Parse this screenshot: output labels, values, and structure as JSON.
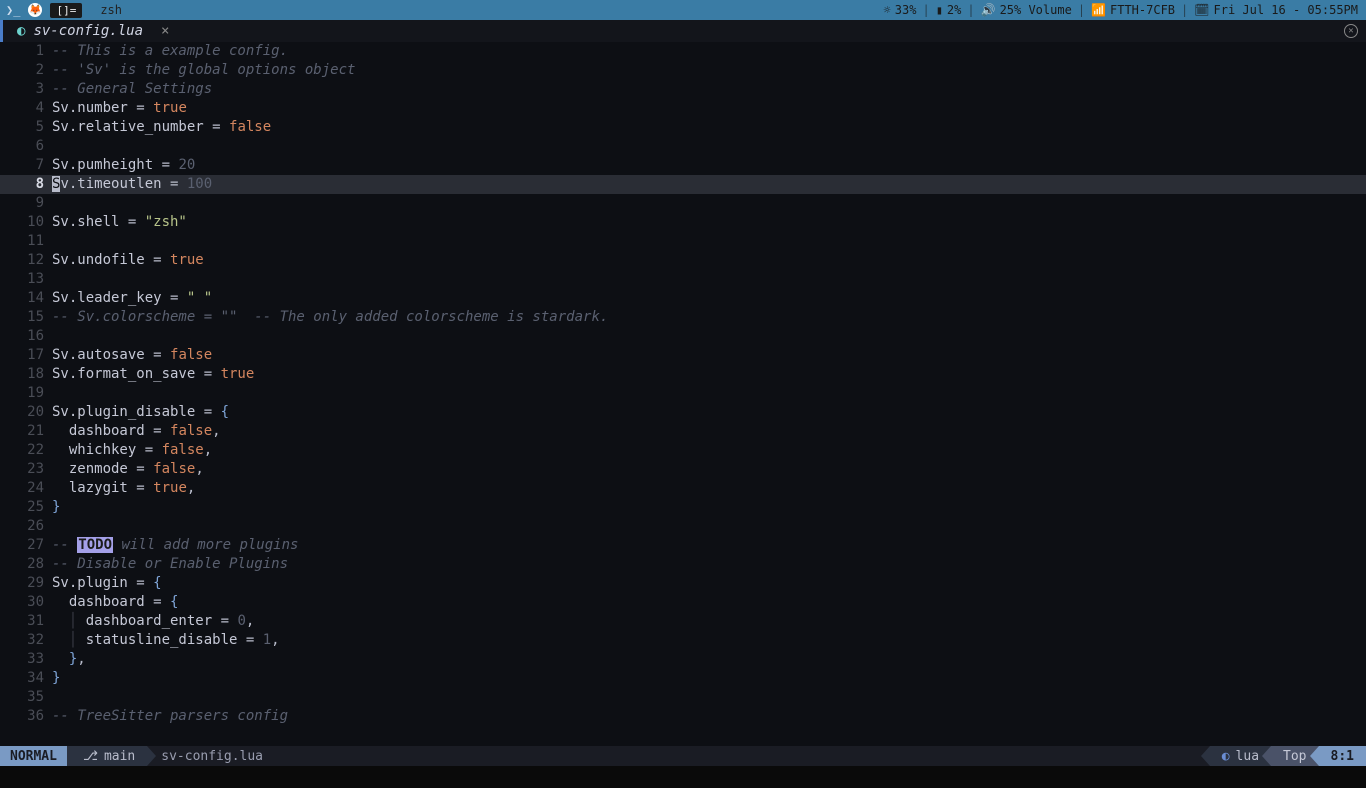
{
  "topbar": {
    "workspace": "[]=",
    "title": "zsh",
    "brightness": "33%",
    "battery": "2%",
    "volume": "25% Volume",
    "wifi": "FTTH-7CFB",
    "datetime": "Fri Jul 16 - 05:55PM"
  },
  "tab": {
    "filename": "sv-config.lua",
    "close": "×"
  },
  "statusline": {
    "mode": "NORMAL",
    "branch": "main",
    "file": "sv-config.lua",
    "filetype": "lua",
    "percent": "Top",
    "position": "8:1"
  },
  "cursor_line": 8,
  "code": [
    {
      "n": 1,
      "seg": [
        [
          "c-comment",
          "-- This is a example config."
        ]
      ]
    },
    {
      "n": 2,
      "seg": [
        [
          "c-comment",
          "-- 'Sv' is the global options object"
        ]
      ]
    },
    {
      "n": 3,
      "seg": [
        [
          "c-comment",
          "-- General Settings"
        ]
      ]
    },
    {
      "n": 4,
      "seg": [
        [
          "c-ident",
          "Sv.number "
        ],
        [
          "c-op",
          "= "
        ],
        [
          "c-kw-true",
          "true"
        ]
      ]
    },
    {
      "n": 5,
      "seg": [
        [
          "c-ident",
          "Sv.relative_number "
        ],
        [
          "c-op",
          "= "
        ],
        [
          "c-kw-false",
          "false"
        ]
      ]
    },
    {
      "n": 6,
      "seg": []
    },
    {
      "n": 7,
      "seg": [
        [
          "c-ident",
          "Sv.pumheight "
        ],
        [
          "c-op",
          "= "
        ],
        [
          "c-num",
          "20"
        ]
      ]
    },
    {
      "n": 8,
      "cursor": true,
      "seg": [
        [
          "cursor-char",
          "S"
        ],
        [
          "c-ident",
          "v.timeoutlen "
        ],
        [
          "c-op",
          "= "
        ],
        [
          "c-num",
          "100"
        ]
      ]
    },
    {
      "n": 9,
      "seg": []
    },
    {
      "n": 10,
      "seg": [
        [
          "c-ident",
          "Sv.shell "
        ],
        [
          "c-op",
          "= "
        ],
        [
          "c-str",
          "\"zsh\""
        ]
      ]
    },
    {
      "n": 11,
      "seg": []
    },
    {
      "n": 12,
      "seg": [
        [
          "c-ident",
          "Sv.undofile "
        ],
        [
          "c-op",
          "= "
        ],
        [
          "c-kw-true",
          "true"
        ]
      ]
    },
    {
      "n": 13,
      "seg": []
    },
    {
      "n": 14,
      "seg": [
        [
          "c-ident",
          "Sv.leader_key "
        ],
        [
          "c-op",
          "= "
        ],
        [
          "c-str",
          "\" \""
        ]
      ]
    },
    {
      "n": 15,
      "seg": [
        [
          "c-comment",
          "-- Sv.colorscheme = \"\"  -- The only added colorscheme is stardark."
        ]
      ]
    },
    {
      "n": 16,
      "seg": []
    },
    {
      "n": 17,
      "seg": [
        [
          "c-ident",
          "Sv.autosave "
        ],
        [
          "c-op",
          "= "
        ],
        [
          "c-kw-false",
          "false"
        ]
      ]
    },
    {
      "n": 18,
      "seg": [
        [
          "c-ident",
          "Sv.format_on_save "
        ],
        [
          "c-op",
          "= "
        ],
        [
          "c-kw-true",
          "true"
        ]
      ]
    },
    {
      "n": 19,
      "seg": []
    },
    {
      "n": 20,
      "seg": [
        [
          "c-ident",
          "Sv.plugin_disable "
        ],
        [
          "c-op",
          "= "
        ],
        [
          "c-brace",
          "{"
        ]
      ]
    },
    {
      "n": 21,
      "seg": [
        [
          "c-ident",
          "  dashboard "
        ],
        [
          "c-op",
          "= "
        ],
        [
          "c-kw-false",
          "false"
        ],
        [
          "c-op",
          ","
        ]
      ]
    },
    {
      "n": 22,
      "seg": [
        [
          "c-ident",
          "  whichkey "
        ],
        [
          "c-op",
          "= "
        ],
        [
          "c-kw-false",
          "false"
        ],
        [
          "c-op",
          ","
        ]
      ]
    },
    {
      "n": 23,
      "seg": [
        [
          "c-ident",
          "  zenmode "
        ],
        [
          "c-op",
          "= "
        ],
        [
          "c-kw-false",
          "false"
        ],
        [
          "c-op",
          ","
        ]
      ]
    },
    {
      "n": 24,
      "seg": [
        [
          "c-ident",
          "  lazygit "
        ],
        [
          "c-op",
          "= "
        ],
        [
          "c-kw-true",
          "true"
        ],
        [
          "c-op",
          ","
        ]
      ]
    },
    {
      "n": 25,
      "seg": [
        [
          "c-brace",
          "}"
        ]
      ]
    },
    {
      "n": 26,
      "seg": []
    },
    {
      "n": 27,
      "seg": [
        [
          "c-comment",
          "-- "
        ],
        [
          "c-todo",
          "TODO"
        ],
        [
          "c-comment",
          " will add more plugins"
        ]
      ]
    },
    {
      "n": 28,
      "seg": [
        [
          "c-comment",
          "-- Disable or Enable Plugins"
        ]
      ]
    },
    {
      "n": 29,
      "seg": [
        [
          "c-ident",
          "Sv.plugin "
        ],
        [
          "c-op",
          "= "
        ],
        [
          "c-brace",
          "{"
        ]
      ]
    },
    {
      "n": 30,
      "seg": [
        [
          "c-ident",
          "  dashboard "
        ],
        [
          "c-op",
          "= "
        ],
        [
          "c-brace",
          "{"
        ]
      ]
    },
    {
      "n": 31,
      "seg": [
        [
          "c-indent",
          "  │ "
        ],
        [
          "c-ident",
          "dashboard_enter "
        ],
        [
          "c-op",
          "= "
        ],
        [
          "c-num",
          "0"
        ],
        [
          "c-op",
          ","
        ]
      ]
    },
    {
      "n": 32,
      "seg": [
        [
          "c-indent",
          "  │ "
        ],
        [
          "c-ident",
          "statusline_disable "
        ],
        [
          "c-op",
          "= "
        ],
        [
          "c-num",
          "1"
        ],
        [
          "c-op",
          ","
        ]
      ]
    },
    {
      "n": 33,
      "seg": [
        [
          "c-ident",
          "  "
        ],
        [
          "c-brace",
          "}"
        ],
        [
          "c-op",
          ","
        ]
      ]
    },
    {
      "n": 34,
      "seg": [
        [
          "c-brace",
          "}"
        ]
      ]
    },
    {
      "n": 35,
      "seg": []
    },
    {
      "n": 36,
      "seg": [
        [
          "c-comment",
          "-- TreeSitter parsers config"
        ]
      ]
    }
  ]
}
